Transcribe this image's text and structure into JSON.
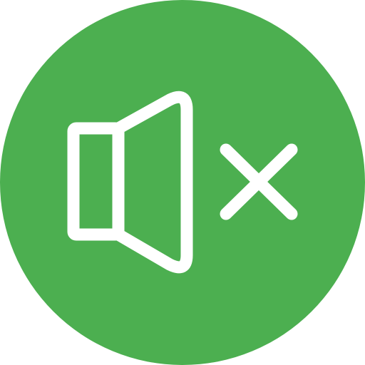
{
  "mute_button": {
    "icon": "speaker-muted-icon",
    "background_color": "#4CAF50",
    "stroke_color": "#ffffff",
    "state": "muted"
  }
}
